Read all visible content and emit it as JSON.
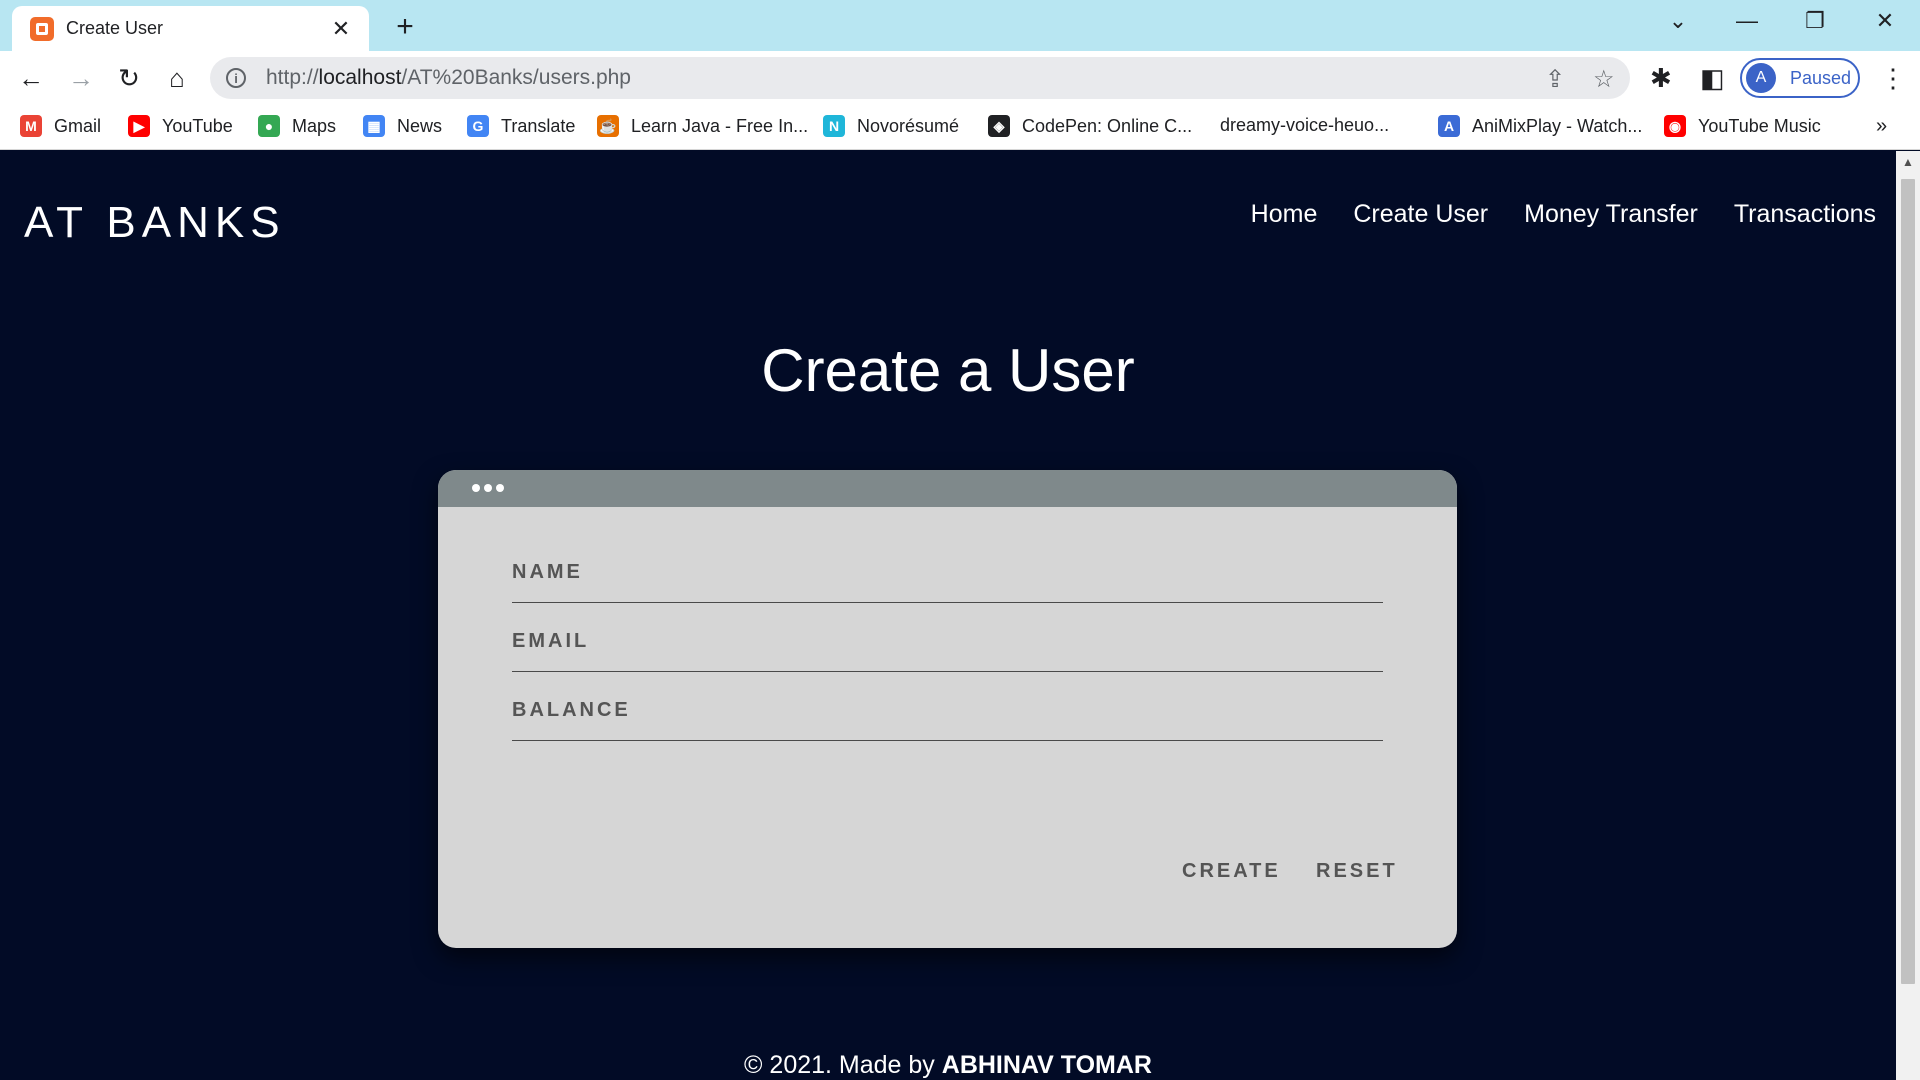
{
  "browser": {
    "tab_title": "Create User",
    "url_prefix": "http://",
    "url_host": "localhost",
    "url_path": "/AT%20Banks/users.php",
    "profile_initial": "A",
    "profile_status": "Paused"
  },
  "bookmarks": [
    {
      "label": "Gmail",
      "icon": "gmail-icon",
      "color": "#ea4335",
      "glyph": "M"
    },
    {
      "label": "YouTube",
      "icon": "youtube-icon",
      "color": "#ff0000",
      "glyph": "▶"
    },
    {
      "label": "Maps",
      "icon": "maps-icon",
      "color": "#34a853",
      "glyph": "●"
    },
    {
      "label": "News",
      "icon": "news-icon",
      "color": "#4285f4",
      "glyph": "▦"
    },
    {
      "label": "Translate",
      "icon": "translate-icon",
      "color": "#4285f4",
      "glyph": "G"
    },
    {
      "label": "Learn Java - Free In...",
      "icon": "java-icon",
      "color": "#e76f00",
      "glyph": "☕"
    },
    {
      "label": "Novorésumé",
      "icon": "novoresume-icon",
      "color": "#1fb6d9",
      "glyph": "N"
    },
    {
      "label": "CodePen: Online C...",
      "icon": "codepen-icon",
      "color": "#202124",
      "glyph": "◈"
    },
    {
      "label": "dreamy-voice-heuo...",
      "icon": "",
      "color": "#ffffff",
      "glyph": ""
    },
    {
      "label": "AniMixPlay - Watch...",
      "icon": "animixplay-icon",
      "color": "#3b6bd6",
      "glyph": "A"
    },
    {
      "label": "YouTube Music",
      "icon": "youtube-music-icon",
      "color": "#ff0000",
      "glyph": "◉"
    }
  ],
  "site": {
    "logo": "AT BANKS",
    "nav": [
      "Home",
      "Create User",
      "Money Transfer",
      "Transactions"
    ]
  },
  "main": {
    "heading": "Create a User",
    "fields": [
      {
        "label": "NAME"
      },
      {
        "label": "EMAIL"
      },
      {
        "label": "BALANCE"
      }
    ],
    "create_label": "CREATE",
    "reset_label": "RESET"
  },
  "footer": {
    "text": "© 2021. Made by ",
    "author": "ABHINAV TOMAR"
  }
}
